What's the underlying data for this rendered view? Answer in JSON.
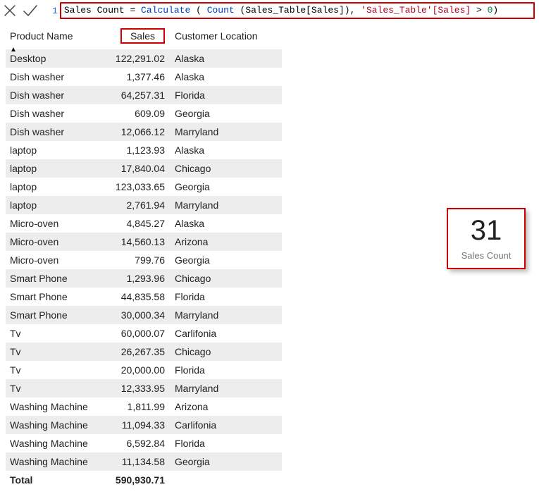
{
  "formula": {
    "line_number": "1",
    "tokens": [
      {
        "t": "Sales Count ",
        "c": "black"
      },
      {
        "t": "=",
        "c": "black"
      },
      {
        "t": " Calculate ",
        "c": "blue"
      },
      {
        "t": "( ",
        "c": "black"
      },
      {
        "t": "Count ",
        "c": "blue"
      },
      {
        "t": "(",
        "c": "black"
      },
      {
        "t": "Sales_Table[Sales]",
        "c": "black"
      },
      {
        "t": "), ",
        "c": "black"
      },
      {
        "t": "'Sales_Table'[Sales]",
        "c": "red"
      },
      {
        "t": " > ",
        "c": "black"
      },
      {
        "t": "0",
        "c": "green"
      },
      {
        "t": ")",
        "c": "black"
      }
    ]
  },
  "toolbar": {
    "cancel_icon": "cancel",
    "confirm_icon": "confirm"
  },
  "table": {
    "headers": {
      "product": "Product Name",
      "sales": "Sales",
      "location": "Customer Location"
    },
    "highlight_header": "sales",
    "rows": [
      {
        "product": "Desktop",
        "sales": "122,291.02",
        "location": "Alaska"
      },
      {
        "product": "Dish washer",
        "sales": "1,377.46",
        "location": "Alaska"
      },
      {
        "product": "Dish washer",
        "sales": "64,257.31",
        "location": "Florida"
      },
      {
        "product": "Dish washer",
        "sales": "609.09",
        "location": "Georgia"
      },
      {
        "product": "Dish washer",
        "sales": "12,066.12",
        "location": "Marryland"
      },
      {
        "product": "laptop",
        "sales": "1,123.93",
        "location": "Alaska"
      },
      {
        "product": "laptop",
        "sales": "17,840.04",
        "location": "Chicago"
      },
      {
        "product": "laptop",
        "sales": "123,033.65",
        "location": "Georgia"
      },
      {
        "product": "laptop",
        "sales": "2,761.94",
        "location": "Marryland"
      },
      {
        "product": "Micro-oven",
        "sales": "4,845.27",
        "location": "Alaska"
      },
      {
        "product": "Micro-oven",
        "sales": "14,560.13",
        "location": "Arizona"
      },
      {
        "product": "Micro-oven",
        "sales": "799.76",
        "location": "Georgia"
      },
      {
        "product": "Smart Phone",
        "sales": "1,293.96",
        "location": "Chicago"
      },
      {
        "product": "Smart Phone",
        "sales": "44,835.58",
        "location": "Florida"
      },
      {
        "product": "Smart Phone",
        "sales": "30,000.34",
        "location": "Marryland"
      },
      {
        "product": "Tv",
        "sales": "60,000.07",
        "location": "Carlifonia"
      },
      {
        "product": "Tv",
        "sales": "26,267.35",
        "location": "Chicago"
      },
      {
        "product": "Tv",
        "sales": "20,000.00",
        "location": "Florida"
      },
      {
        "product": "Tv",
        "sales": "12,333.95",
        "location": "Marryland"
      },
      {
        "product": "Washing Machine",
        "sales": "1,811.99",
        "location": "Arizona"
      },
      {
        "product": "Washing Machine",
        "sales": "11,094.33",
        "location": "Carlifonia"
      },
      {
        "product": "Washing Machine",
        "sales": "6,592.84",
        "location": "Florida"
      },
      {
        "product": "Washing Machine",
        "sales": "11,134.58",
        "location": "Georgia"
      }
    ],
    "footer": {
      "label": "Total",
      "value": "590,930.71"
    }
  },
  "card": {
    "value": "31",
    "label": "Sales Count"
  }
}
